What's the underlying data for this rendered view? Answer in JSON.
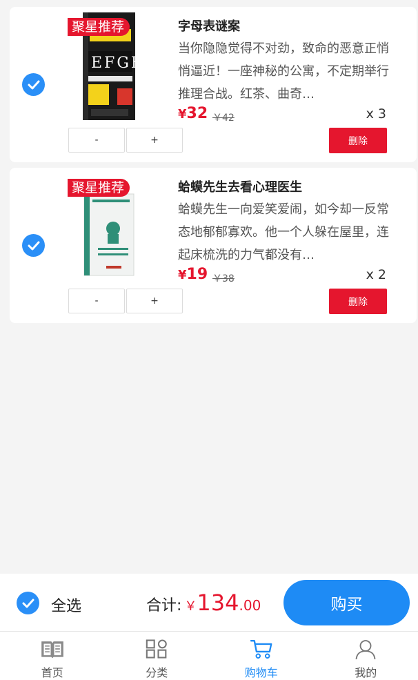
{
  "cart": {
    "items": [
      {
        "tag": "聚星推荐",
        "title": "字母表谜案",
        "description": "当你隐隐觉得不对劲，致命的恶意正悄悄逼近！一座神秘的公寓，不定期举行推理合战。红茶、曲奇…",
        "price_symbol": "¥",
        "price": "32",
        "original_price": "￥42",
        "quantity": "x 3",
        "minus_label": "-",
        "plus_label": "+",
        "delete_label": "删除",
        "checked": true
      },
      {
        "tag": "聚星推荐",
        "title": "蛤蟆先生去看心理医生",
        "description": "蛤蟆先生一向爱笑爱闹，如今却一反常态地郁郁寡欢。他一个人躲在屋里，连起床梳洗的力气都没有…",
        "price_symbol": "¥",
        "price": "19",
        "original_price": "￥38",
        "quantity": "x 2",
        "minus_label": "-",
        "plus_label": "+",
        "delete_label": "删除",
        "checked": true
      }
    ]
  },
  "checkout": {
    "select_all_label": "全选",
    "total_label": "合计:",
    "currency_symbol": "￥",
    "total_integer": "134",
    "total_decimal": ".00",
    "buy_label": "购买"
  },
  "tabbar": {
    "tabs": [
      {
        "label": "首页",
        "icon": "book-icon"
      },
      {
        "label": "分类",
        "icon": "category-grid-icon"
      },
      {
        "label": "购物车",
        "icon": "cart-icon",
        "active": true
      },
      {
        "label": "我的",
        "icon": "user-icon"
      }
    ]
  },
  "colors": {
    "accent_blue": "#1e8bf5",
    "price_red": "#e5162e"
  }
}
